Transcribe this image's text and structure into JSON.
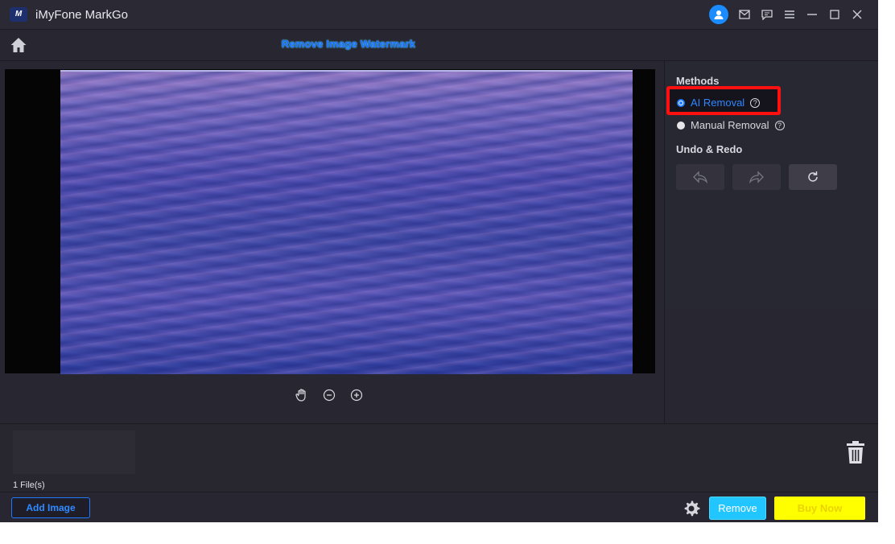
{
  "window": {
    "logo_text": "M",
    "title": "iMyFone MarkGo",
    "icons": [
      "user-avatar-icon",
      "mail-icon",
      "feedback-icon",
      "menu-icon",
      "minimize-icon",
      "maximize-icon",
      "close-icon"
    ]
  },
  "header": {
    "title": "Remove Image Watermark",
    "home_icon": "home-icon"
  },
  "canvas": {
    "tools": [
      "hand-pan-icon",
      "zoom-out-icon",
      "zoom-in-icon"
    ]
  },
  "sidebar": {
    "methods_label": "Methods",
    "methods": [
      {
        "label": "AI Removal",
        "selected": true
      },
      {
        "label": "Manual Removal",
        "selected": false
      }
    ],
    "help_glyph": "?",
    "undo_redo_label": "Undo & Redo"
  },
  "files": {
    "count_label": "1 File(s)"
  },
  "footer": {
    "add_image_label": "Add Image",
    "remove_label": "Remove",
    "buy_now_label": "Buy Now"
  },
  "colors": {
    "accent_blue": "#1e7bff",
    "remove_button": "#21c5ff",
    "buy_button": "#ffff00",
    "highlight": "#ff1010"
  }
}
